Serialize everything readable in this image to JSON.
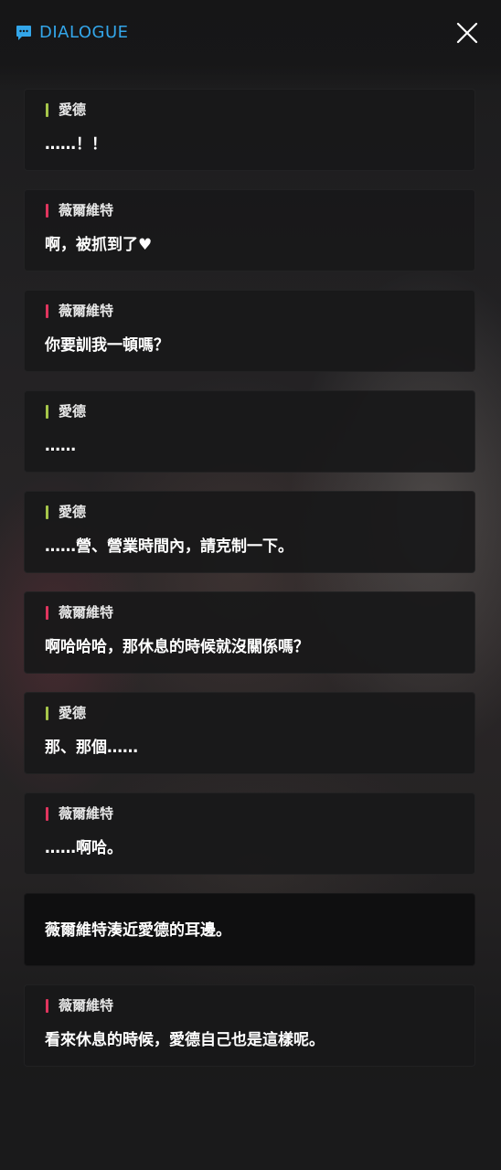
{
  "header": {
    "title": "DIALOGUE",
    "icon": "chat-bubble-icon",
    "close_icon": "close-icon",
    "accent_color": "#33a6ea"
  },
  "colors": {
    "ade": "#a6c64a",
    "vivian": "#e0355e"
  },
  "dialogue": [
    {
      "speaker": "愛德",
      "color": "#a6c64a",
      "text": "……！！"
    },
    {
      "speaker": "薇爾維特",
      "color": "#e0355e",
      "text": "啊，被抓到了♥"
    },
    {
      "speaker": "薇爾維特",
      "color": "#e0355e",
      "text": "你要訓我一頓嗎？"
    },
    {
      "speaker": "愛德",
      "color": "#a6c64a",
      "text": "……"
    },
    {
      "speaker": "愛德",
      "color": "#a6c64a",
      "text": "……營、營業時間內，請克制一下。"
    },
    {
      "speaker": "薇爾維特",
      "color": "#e0355e",
      "text": "啊哈哈哈，那休息的時候就沒關係嗎？"
    },
    {
      "speaker": "愛德",
      "color": "#a6c64a",
      "text": "那、那個……"
    },
    {
      "speaker": "薇爾維特",
      "color": "#e0355e",
      "text": "……啊哈。"
    },
    {
      "speaker": "",
      "color": "",
      "text": "薇爾維特湊近愛德的耳邊。"
    },
    {
      "speaker": "薇爾維特",
      "color": "#e0355e",
      "text": "看來休息的時候，愛德自己也是這樣呢。"
    }
  ]
}
